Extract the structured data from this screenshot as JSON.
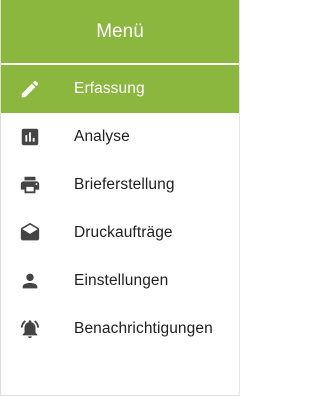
{
  "header": {
    "title": "Menü"
  },
  "colors": {
    "accent": "#8bb73f",
    "icon": "#444444",
    "text": "#202020"
  },
  "menu": {
    "items": [
      {
        "label": "Erfassung",
        "icon": "pencil-icon",
        "active": true
      },
      {
        "label": "Analyse",
        "icon": "bar-chart-icon",
        "active": false
      },
      {
        "label": "Brieferstellung",
        "icon": "printer-icon",
        "active": false
      },
      {
        "label": "Druckaufträge",
        "icon": "envelope-open-icon",
        "active": false
      },
      {
        "label": "Einstellungen",
        "icon": "person-icon",
        "active": false
      },
      {
        "label": "Benachrichtigungen",
        "icon": "bell-ringing-icon",
        "active": false
      }
    ]
  }
}
